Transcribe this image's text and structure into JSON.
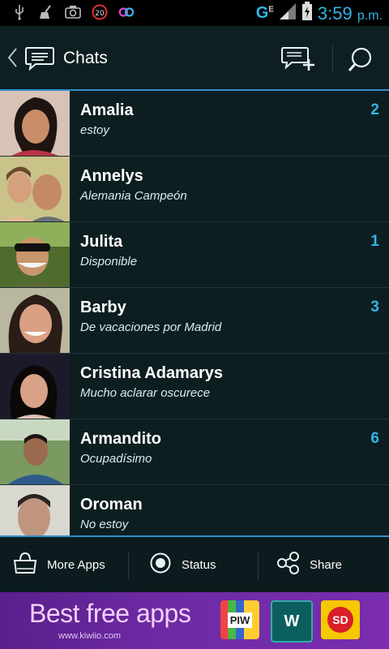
{
  "status_bar": {
    "network": "G",
    "network_sub": "E",
    "time": "3:59",
    "ampm": "p.m.",
    "icons": [
      "usb-icon",
      "broom-icon",
      "camera-icon",
      "speed-20-icon",
      "logo-80-icon",
      "signal-icon",
      "battery-icon"
    ]
  },
  "action_bar": {
    "title": "Chats",
    "icons": [
      "back-chevron-icon",
      "chat-logo-icon",
      "new-chat-icon",
      "search-icon"
    ]
  },
  "chats": [
    {
      "name": "Amalia",
      "status": "estoy",
      "badge": "2"
    },
    {
      "name": "Annelys",
      "status": "Alemania Campeón",
      "badge": ""
    },
    {
      "name": "Julita",
      "status": "Disponible",
      "badge": "1"
    },
    {
      "name": "Barby",
      "status": "De vacaciones por Madrid",
      "badge": "3"
    },
    {
      "name": "Cristina Adamarys",
      "status": "Mucho aclarar oscurece",
      "badge": ""
    },
    {
      "name": "Armandito",
      "status": "Ocupadísimo",
      "badge": "6"
    },
    {
      "name": "Oroman",
      "status": "No estoy",
      "badge": ""
    }
  ],
  "bottom_tabs": [
    {
      "label": "More Apps",
      "icon": "shopping-bag-icon"
    },
    {
      "label": "Status",
      "icon": "radio-dot-icon"
    },
    {
      "label": "Share",
      "icon": "share-nodes-icon"
    }
  ],
  "ad": {
    "headline": "Best free apps",
    "url": "www.kiwiio.com",
    "apps": [
      {
        "label": "PIW"
      },
      {
        "label": "W"
      },
      {
        "label": "SD"
      }
    ]
  },
  "colors": {
    "accent": "#33b5e5",
    "background": "#0d1e21",
    "divider": "#2f8fcf",
    "ad_background": "#6d2aa3"
  }
}
